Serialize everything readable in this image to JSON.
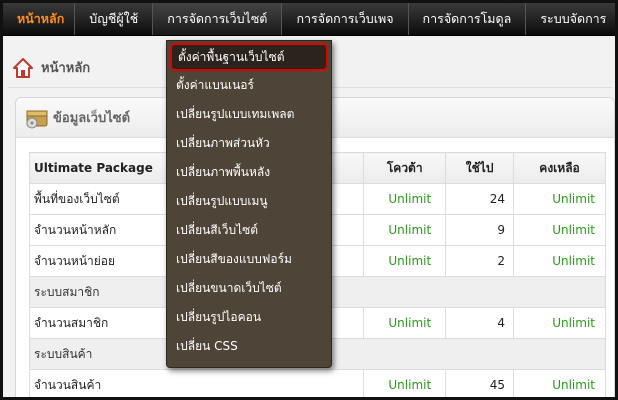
{
  "nav": {
    "items": [
      "หน้าหลัก",
      "บัญชีผู้ใช้",
      "การจัดการเว็บไซต์",
      "การจัดการเว็บเพจ",
      "การจัดการโมดูล",
      "ระบบจัดการ"
    ]
  },
  "breadcrumb": {
    "title": "หน้าหลัก"
  },
  "panel": {
    "title": "ข้อมูลเว็บไซต์"
  },
  "table": {
    "headers": [
      "Ultimate Package",
      "โควต้า",
      "ใช้ไป",
      "คงเหลือ"
    ],
    "rows": [
      {
        "name": "พื้นที่ของเว็บไซต์",
        "quota": "Unlimit",
        "used": "24",
        "remain": "Unlimit"
      },
      {
        "name": "จำนวนหน้าหลัก",
        "quota": "Unlimit",
        "used": "9",
        "remain": "Unlimit"
      },
      {
        "name": "จำนวนหน้าย่อย",
        "quota": "Unlimit",
        "used": "2",
        "remain": "Unlimit"
      },
      {
        "name": "ระบบสมาชิก",
        "section": true
      },
      {
        "name": "จำนวนสมาชิก",
        "quota": "Unlimit",
        "used": "4",
        "remain": "Unlimit"
      },
      {
        "name": "ระบบสินค้า",
        "section": true
      },
      {
        "name": "จำนวนสินค้า",
        "quota": "Unlimit",
        "used": "45",
        "remain": "Unlimit"
      }
    ]
  },
  "dropdown": {
    "items": [
      "ตั้งค่าพื้นฐานเว็บไซต์",
      "ตั้งค่าแบนเนอร์",
      "เปลี่ยนรูปแบบเทมเพลต",
      "เปลี่ยนภาพส่วนหัว",
      "เปลี่ยนภาพพื้นหลัง",
      "เปลี่ยนรูปแบบเมนู",
      "เปลี่ยนสีเว็บไซต์",
      "เปลี่ยนสีของแบบฟอร์ม",
      "เปลี่ยนขนาดเว็บไซต์",
      "เปลี่ยนรูปไอคอน",
      "เปลี่ยน CSS"
    ]
  },
  "colors": {
    "accent": "#ff8c1a",
    "highlight_border": "#e00000",
    "value_green": "#2a9a1a"
  },
  "icons": {
    "home": "home-icon",
    "panel": "box-icon"
  }
}
